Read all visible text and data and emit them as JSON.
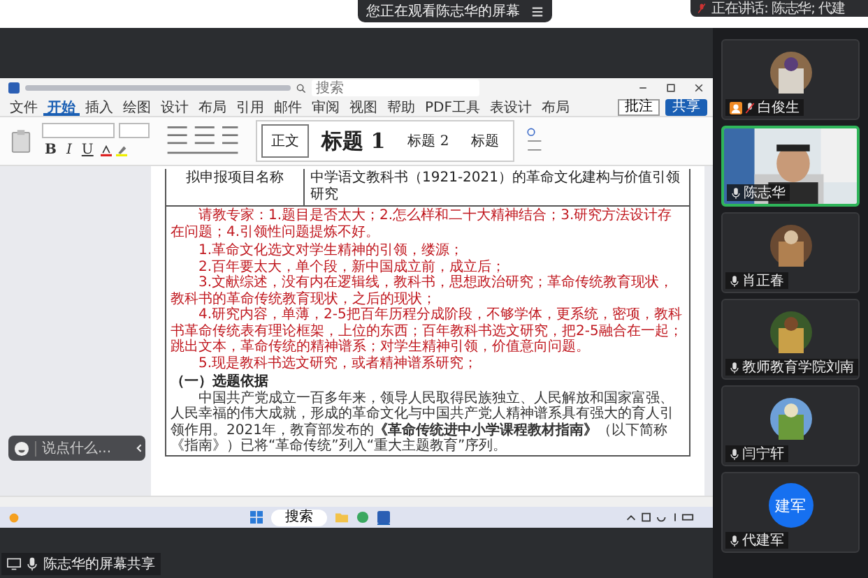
{
  "top_banner": {
    "text": "您正在观看陈志华的屏幕"
  },
  "speaking_banner": {
    "text": "正在讲话: 陈志华; 代建"
  },
  "word": {
    "tabs": [
      {
        "label": "文件",
        "selected": false
      },
      {
        "label": "开始",
        "selected": true
      },
      {
        "label": "插入",
        "selected": false
      },
      {
        "label": "绘图",
        "selected": false
      },
      {
        "label": "设计",
        "selected": false
      },
      {
        "label": "布局",
        "selected": false
      },
      {
        "label": "引用",
        "selected": false
      },
      {
        "label": "邮件",
        "selected": false
      },
      {
        "label": "审阅",
        "selected": false
      },
      {
        "label": "视图",
        "selected": false
      },
      {
        "label": "帮助",
        "selected": false
      },
      {
        "label": "PDF工具",
        "selected": false
      },
      {
        "label": "表设计",
        "selected": false
      },
      {
        "label": "布局",
        "selected": false
      }
    ],
    "search": {
      "placeholder": "搜索"
    },
    "comment_button": "批注",
    "share_button": "共享",
    "format_buttons": [
      "B",
      "I",
      "U"
    ],
    "styles": [
      {
        "label": "正文",
        "kind": "small",
        "selected": true
      },
      {
        "label": "标题 1",
        "kind": "large",
        "selected": false
      },
      {
        "label": "标题 2",
        "kind": "small",
        "selected": false
      },
      {
        "label": "标题",
        "kind": "small",
        "selected": false
      }
    ],
    "document": {
      "table": {
        "label": "拟申报项目名称",
        "value": "中学语文教科书（1921-2021）的革命文化建构与价值引领研究"
      },
      "notes": [
        "请教专家：1.题目是否太大；2.怎么样和二十大精神结合；3.研究方法设计存在问题；4.引领性问题提炼不好。",
        "1.革命文化选文对学生精神的引领，缕源；",
        "2.百年要太大，单个段，新中国成立前，成立后；",
        "3.文献综述，没有内在逻辑线，教科书，思想政治研究；革命传统教育现状，教科书的革命传统教育现状，之后的现状；",
        "4.研究内容，单薄，2-5把百年历程分成阶段，不够学体，更系统，密项，教科书革命传统表有理论框架，上位的东西；百年教科书选文研究，把2-5融合在一起；跳出文本，革命传统的精神谱系；对学生精神引领，价值意向问题。",
        "5.现是教科书选文研究，或者精神谱系研究；"
      ],
      "heading": "（一）选题依据",
      "paragraphs": [
        "中国共产党成立一百多年来，领导人民取得民族独立、人民解放和国家富强、人民幸福的伟大成就，形成的革命文化与中国共产党人精神谱系具有强大的育人引领作用。2021年，教育部发布的**《革命传统进中小学课程教材指南》**（以下简称《指南》）已将“革命传统”列入“重大主题教育”序列。"
      ]
    }
  },
  "taskbar": {
    "search": "搜索"
  },
  "chat": {
    "placeholder": "说点什么..."
  },
  "share_label": "陈志华的屏幕共享",
  "participants": [
    {
      "name": "白俊生",
      "kind": "avatar",
      "host": true,
      "muted": true,
      "speaking": false
    },
    {
      "name": "陈志华",
      "kind": "video",
      "host": false,
      "muted": false,
      "speaking": true
    },
    {
      "name": "肖正春",
      "kind": "avatar",
      "host": false,
      "muted": false,
      "speaking": false
    },
    {
      "name": "教师教育学院刘南",
      "kind": "avatar",
      "host": false,
      "muted": false,
      "speaking": false
    },
    {
      "name": "闫宁轩",
      "kind": "avatar",
      "host": false,
      "muted": false,
      "speaking": false
    },
    {
      "name": "代建军",
      "kind": "initials",
      "initials": "建军",
      "host": false,
      "muted": false,
      "speaking": false
    }
  ]
}
